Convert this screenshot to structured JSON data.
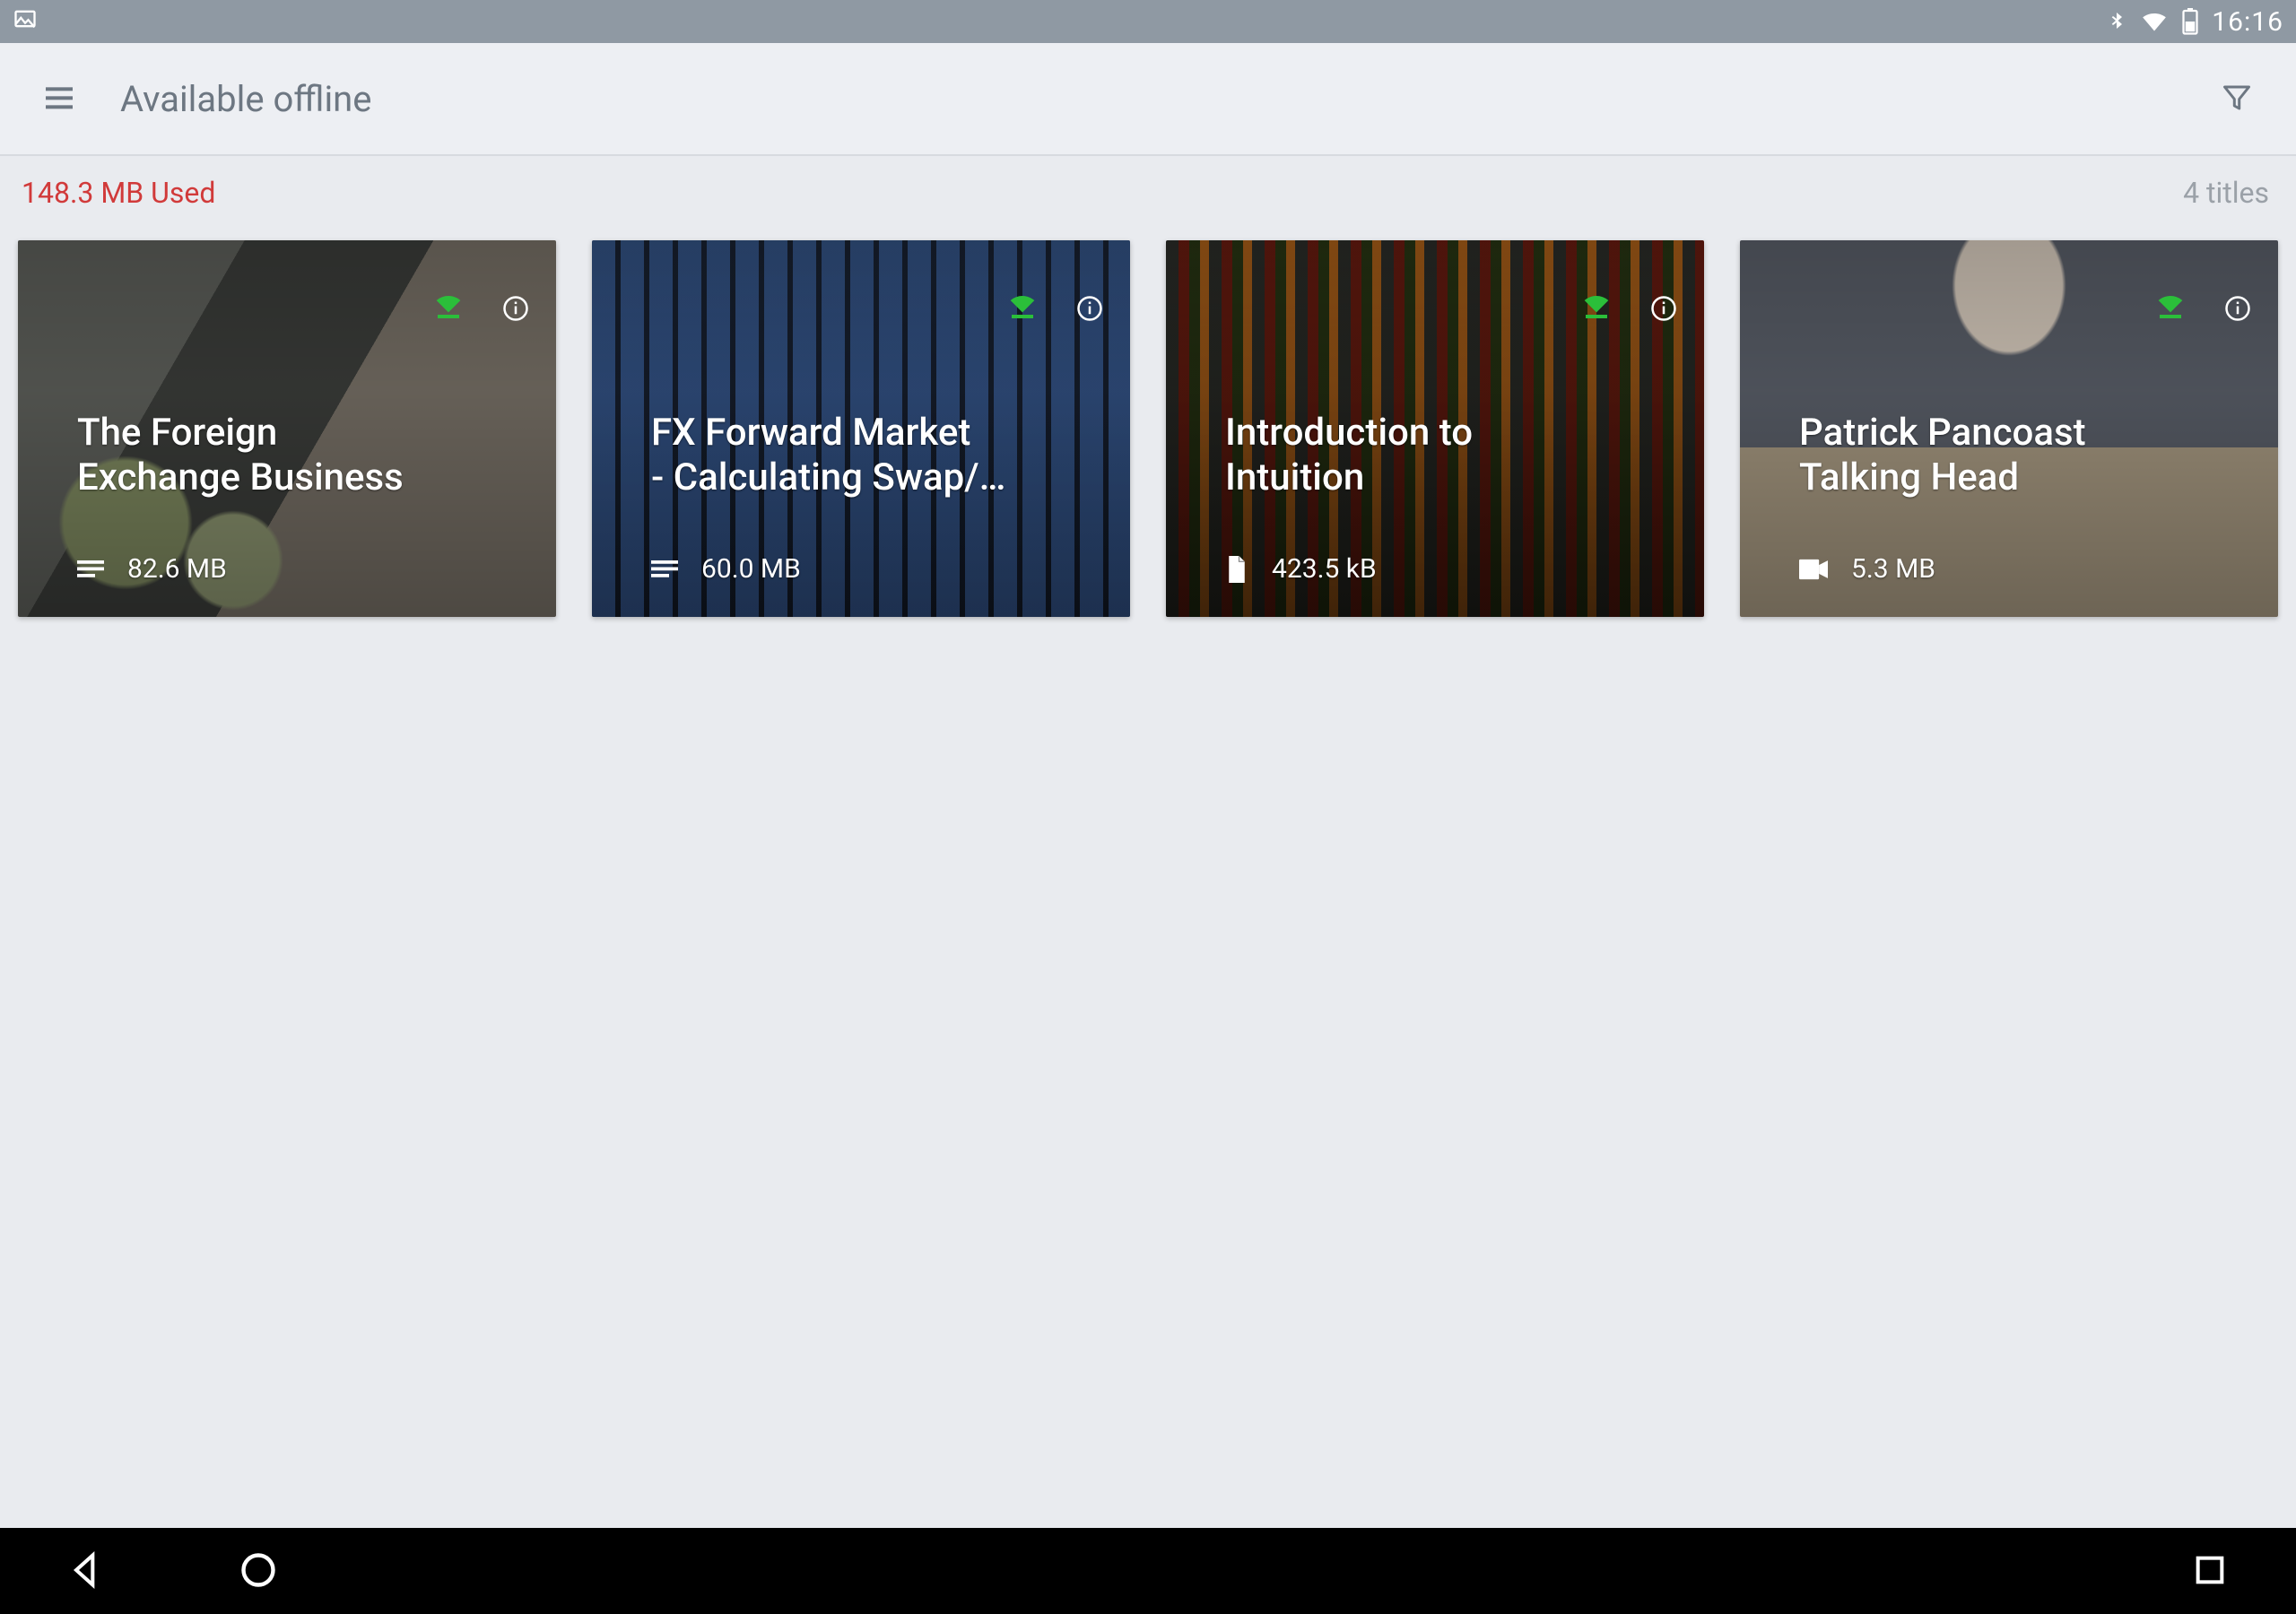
{
  "status_bar": {
    "time": "16:16"
  },
  "toolbar": {
    "title": "Available offline"
  },
  "subheader": {
    "usage": "148.3 MB Used",
    "count": "4 titles"
  },
  "cards": [
    {
      "title": "The Foreign\nExchange Business",
      "size": "82.6 MB",
      "type_icon": "text-lines"
    },
    {
      "title": "FX Forward Market\n- Calculating Swap/…",
      "size": "60.0 MB",
      "type_icon": "text-lines"
    },
    {
      "title": "Introduction to\nIntuition",
      "size": "423.5 kB",
      "type_icon": "document"
    },
    {
      "title": "Patrick Pancoast\nTalking Head",
      "size": "5.3 MB",
      "type_icon": "video"
    }
  ],
  "icons": {
    "hamburger": "menu-icon",
    "filter": "filter-icon",
    "wifi_dl": "wifi-download-icon",
    "info": "info-icon",
    "back": "nav-back-icon",
    "home": "nav-home-icon",
    "recent": "nav-recent-icon",
    "screenshot": "screenshot-indicator-icon",
    "bluetooth": "bluetooth-icon",
    "wifi": "wifi-icon",
    "battery": "battery-icon"
  },
  "colors": {
    "accent_green": "#2bbf3a",
    "usage_red": "#d13a3a",
    "toolbar_bg": "#edeff3",
    "status_bg": "#8f99a3"
  }
}
